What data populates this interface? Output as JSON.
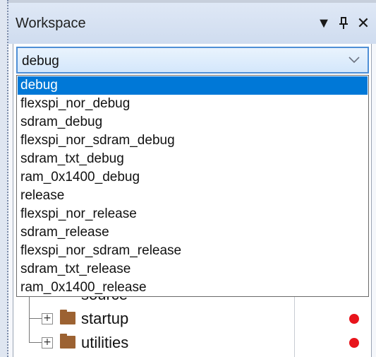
{
  "panel": {
    "title": "Workspace",
    "buttons": {
      "menu_icon": "dropdown-triangle",
      "pin_icon": "pin",
      "close_icon": "close"
    }
  },
  "configuration": {
    "selected": "debug",
    "options": [
      "debug",
      "flexspi_nor_debug",
      "sdram_debug",
      "flexspi_nor_sdram_debug",
      "sdram_txt_debug",
      "ram_0x1400_debug",
      "release",
      "flexspi_nor_release",
      "sdram_release",
      "flexspi_nor_sdram_release",
      "sdram_txt_release",
      "ram_0x1400_release"
    ],
    "highlighted_index": 0
  },
  "tree": {
    "partial_item": "source",
    "items": [
      {
        "label": "startup",
        "expander": "+",
        "status": "red"
      },
      {
        "label": "utilities",
        "expander": "+",
        "status": "red"
      }
    ]
  },
  "colors": {
    "selection": "#0078d7",
    "status_dot": "#e8141b",
    "folder": "#9c6232",
    "combo_border": "#4f8fd6"
  }
}
